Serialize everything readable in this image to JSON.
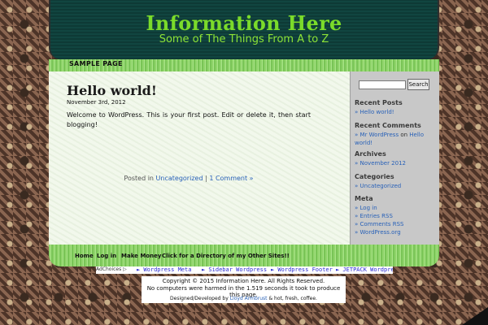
{
  "header": {
    "title": "Information Here",
    "description": "Some of The Things From A to Z"
  },
  "nav": {
    "sample_page": "SAMPLE PAGE"
  },
  "post": {
    "title": "Hello world!",
    "date": "November 3rd, 2012",
    "body": "Welcome to WordPress. This is your first post. Edit or delete it, then start blogging!",
    "meta_prefix": "Posted in",
    "category": "Uncategorized",
    "separator": "|",
    "comments": "1 Comment »"
  },
  "sidebar": {
    "search_button": "Search",
    "recent_posts_title": "Recent Posts",
    "recent_posts": [
      "Hello world!"
    ],
    "recent_comments_title": "Recent Comments",
    "recent_comment_author": "Mr WordPress",
    "recent_comment_on": "on",
    "recent_comment_post": "Hello world!",
    "archives_title": "Archives",
    "archives": [
      "November 2012"
    ],
    "categories_title": "Categories",
    "categories": [
      "Uncategorized"
    ],
    "meta_title": "Meta",
    "meta": [
      "Log in",
      "Entries RSS",
      "Comments RSS",
      "WordPress.org"
    ],
    "bullet": "»"
  },
  "footer_nav": [
    "Home",
    "Log in",
    "Make Money",
    "Click for a Directory of my Other Sites!!"
  ],
  "adbar": {
    "adchoices": "AdChoices ▷",
    "links": [
      "► Wordpress Meta",
      "► Sidebar Wordpress",
      "► Wordpress Footer",
      "► JETPACK Wordpress"
    ]
  },
  "footer": {
    "copyright": "Copyright © 2015 Information Here. All Rights Reserved.",
    "timing": "No computers were harmed in the 1.519 seconds it took to produce this page.",
    "designed_prefix": "Designed/Developed by",
    "designer": "Lloyd Armbrust",
    "designed_suffix": "& hot, fresh, coffee."
  },
  "colors": {
    "header_bg": "#0f3f3a",
    "title": "#7bdb2a",
    "nav_green": "#8fd46a",
    "link": "#2a62b8"
  }
}
